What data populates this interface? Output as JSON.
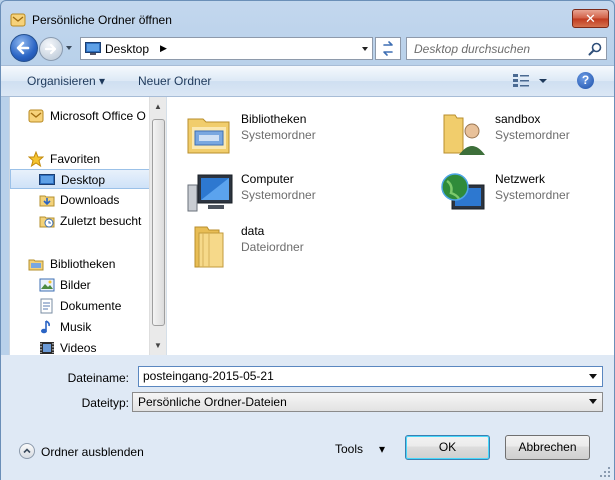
{
  "window": {
    "title": "Persönliche Ordner öffnen",
    "close_label": "✕"
  },
  "address": {
    "location": "Desktop",
    "separator": "▶",
    "search_placeholder": "Desktop durchsuchen"
  },
  "toolbar": {
    "organize_label": "Organisieren ▾",
    "new_folder_label": "Neuer Ordner",
    "help_label": "?"
  },
  "nav": {
    "items": [
      {
        "label": "Microsoft Office O",
        "icon": "outlook-icon"
      },
      {
        "label": "Favoriten",
        "icon": "star-icon"
      },
      {
        "label": "Desktop",
        "icon": "desktop-icon",
        "selected": true
      },
      {
        "label": "Downloads",
        "icon": "downloads-icon"
      },
      {
        "label": "Zuletzt besucht",
        "icon": "recent-places-icon"
      },
      {
        "label": "Bibliotheken",
        "icon": "libraries-icon"
      },
      {
        "label": "Bilder",
        "icon": "pictures-icon"
      },
      {
        "label": "Dokumente",
        "icon": "documents-icon"
      },
      {
        "label": "Musik",
        "icon": "music-icon"
      },
      {
        "label": "Videos",
        "icon": "videos-icon"
      }
    ]
  },
  "content": {
    "items": [
      {
        "name": "Bibliotheken",
        "type": "Systemordner",
        "icon": "libraries-folder-icon"
      },
      {
        "name": "sandbox",
        "type": "Systemordner",
        "icon": "user-folder-icon"
      },
      {
        "name": "Computer",
        "type": "Systemordner",
        "icon": "computer-icon"
      },
      {
        "name": "Netzwerk",
        "type": "Systemordner",
        "icon": "network-icon"
      },
      {
        "name": "data",
        "type": "Dateiordner",
        "icon": "folder-icon"
      }
    ]
  },
  "footer": {
    "filename_label": "Dateiname:",
    "filename_value": "posteingang-2015-05-21",
    "filetype_label": "Dateityp:",
    "filetype_value": "Persönliche Ordner-Dateien",
    "hide_folders_label": "Ordner ausblenden",
    "tools_label": "Tools",
    "tools_arrow": "▾",
    "ok_label": "OK",
    "cancel_label": "Abbrechen"
  },
  "colors": {
    "window_bg": "#b9d1ea",
    "selection": "#cfe2f8",
    "accent": "#3c7fb1"
  }
}
